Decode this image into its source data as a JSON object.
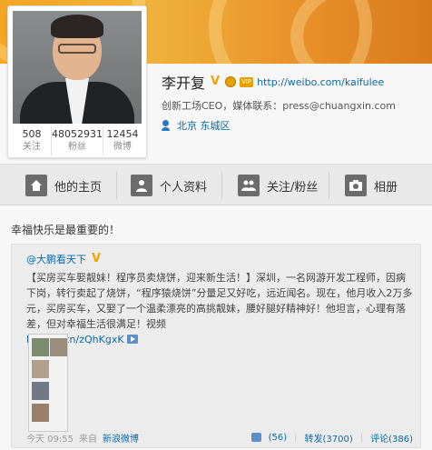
{
  "profile": {
    "name": "李开复",
    "vip_label": "VIP",
    "url": "http://weibo.com/kaifulee",
    "bio": "创新工场CEO，媒体联系：press@chuangxin.com",
    "location": "北京 东城区",
    "stats": [
      {
        "num": "508",
        "label": "关注"
      },
      {
        "num": "48052931",
        "label": "粉丝"
      },
      {
        "num": "12454",
        "label": "微博"
      }
    ]
  },
  "nav": {
    "items": [
      {
        "label": "他的主页",
        "icon": "home-icon"
      },
      {
        "label": "个人资料",
        "icon": "person-icon"
      },
      {
        "label": "关注/粉丝",
        "icon": "people-icon"
      },
      {
        "label": "相册",
        "icon": "camera-icon"
      }
    ]
  },
  "post": {
    "text": "幸福快乐是最重要的！",
    "repost": {
      "author": "@大鹏看天下",
      "text_before": "【买房买车娶靓妹！程序员卖烧饼，迎来新生活！】深圳，一名网游开发工程师，因病下岗，转行卖起了烧饼，“程序猿烧饼”分量足又好吃，远近闻名。现在，他月收入2万多元，买房买车，又娶了一个温柔漂亮的高挑靓妹，腰好腿好精神好！他坦言，心理有落差，但对幸福生活很满足！视频 ",
      "link": "http://t.cn/zQhKgxK",
      "time": "今天 09:55",
      "source_prefix": "来自",
      "source": "新浪微博",
      "likes": "(56)",
      "repost_count": "转发(3700)",
      "comment_count": "评论(386)"
    }
  },
  "colors": {
    "banner": "#f0a52c",
    "link": "#0a6aa8",
    "badge": "#f4a100"
  }
}
